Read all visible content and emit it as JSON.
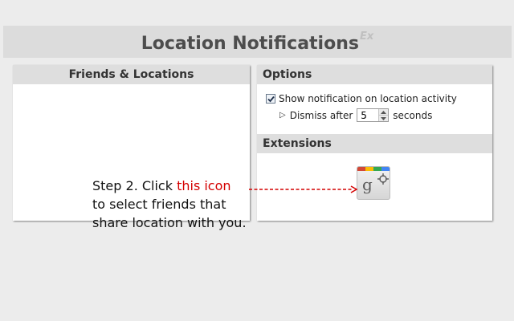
{
  "header": {
    "title": "Location Notifications",
    "suffix": "Ex"
  },
  "friends_panel": {
    "title": "Friends & Locations"
  },
  "options_panel": {
    "title": "Options",
    "show_notification_label": "Show notification on location activity",
    "show_notification_checked": true,
    "dismiss_prefix": "Dismiss after",
    "dismiss_value": "5",
    "dismiss_suffix": "seconds"
  },
  "extensions_panel": {
    "title": "Extensions",
    "icon": "google-plus-location-icon",
    "icon_letter": "g"
  },
  "callout": {
    "line1_prefix": "Step 2. Click ",
    "line1_highlight": "this icon",
    "line2": "to select friends that",
    "line3": "share location with you."
  },
  "colors": {
    "highlight": "#d40000",
    "stripe": [
      "#d34836",
      "#fbbc05",
      "#34a853",
      "#4285f4"
    ]
  }
}
